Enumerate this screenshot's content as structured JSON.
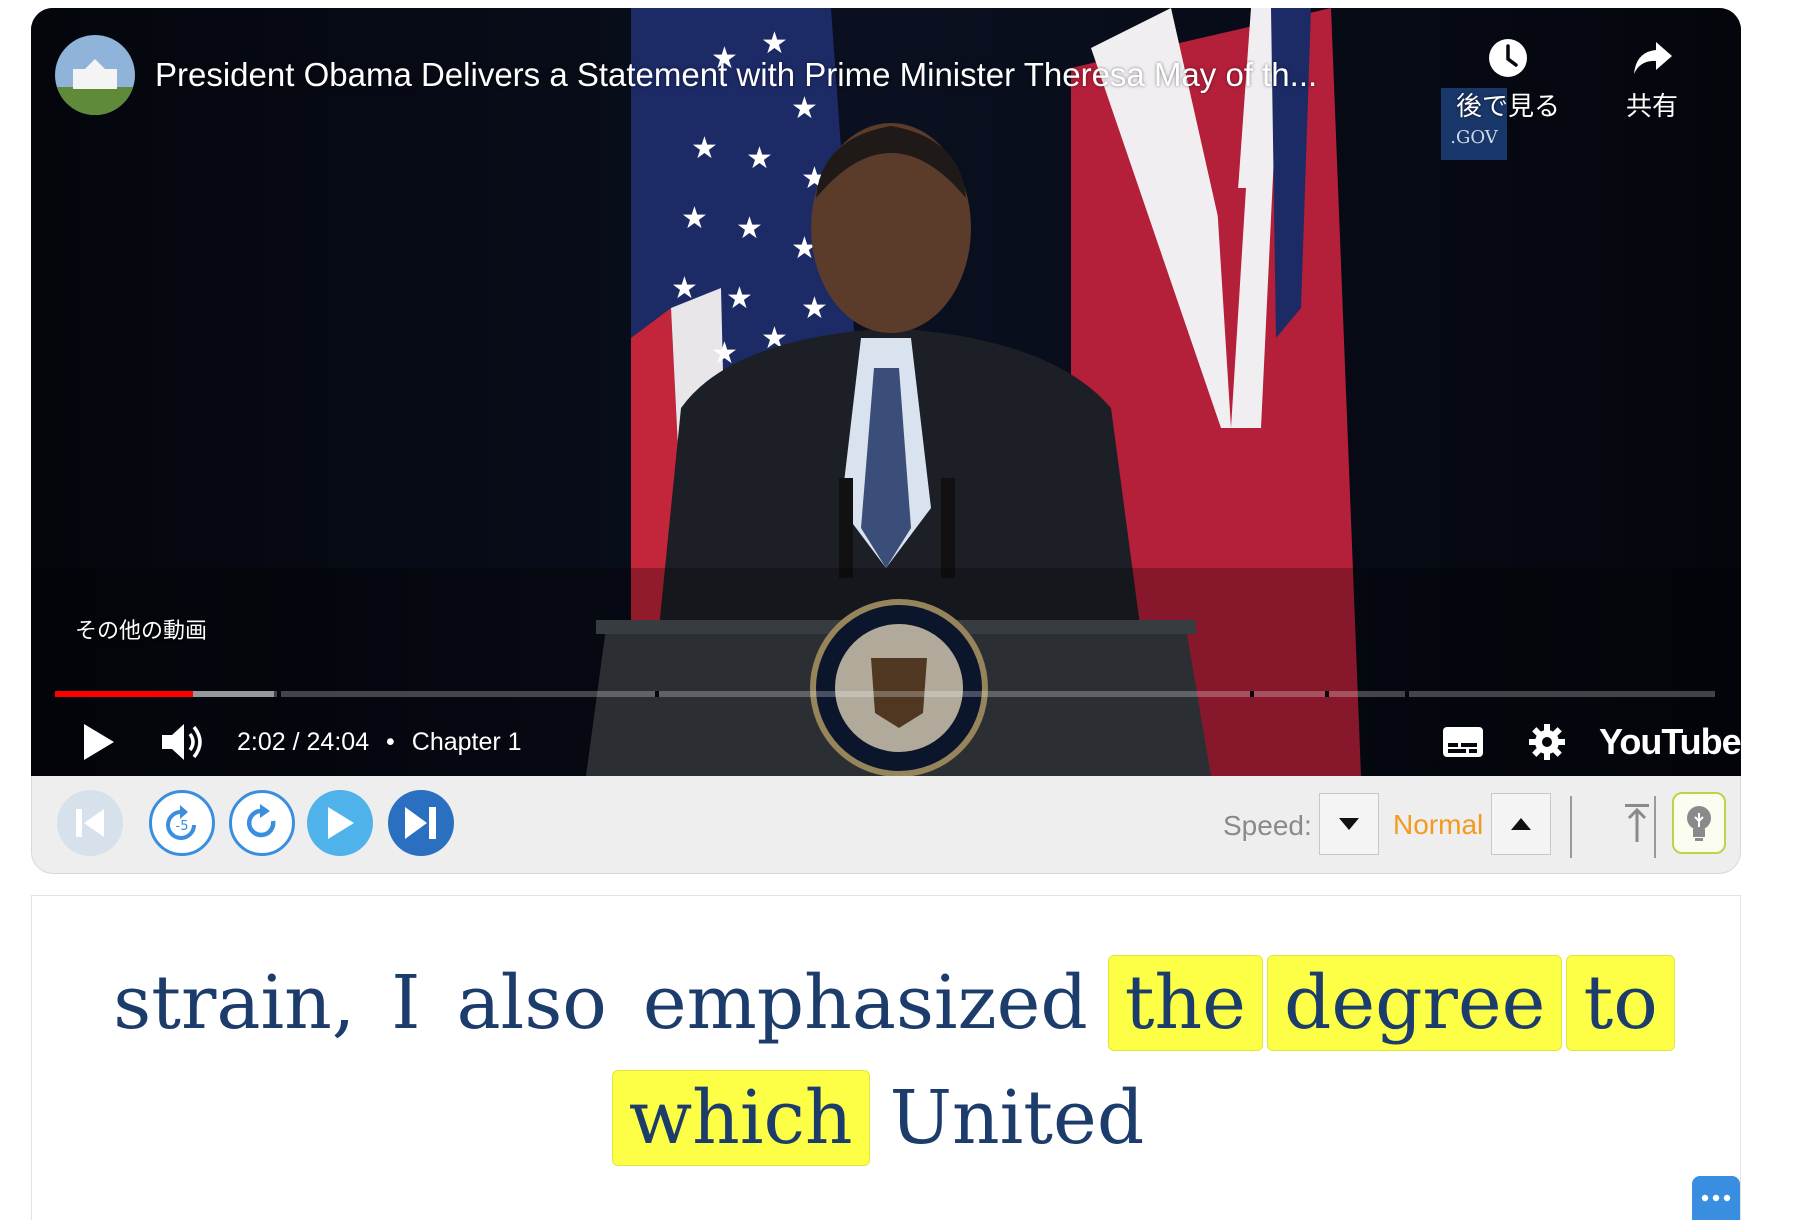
{
  "player": {
    "title": "President Obama Delivers a Statement with Prime Minister Theresa May of th...",
    "watch_later_label": "後で見る",
    "share_label": "共有",
    "more_videos_label": "その他の動画",
    "watermark_text": ".GOV",
    "current_time": "2:02",
    "duration": "24:04",
    "time_separator": "/",
    "chapter_separator": "•",
    "chapter": "Chapter 1",
    "progress_played": 0.083,
    "progress_buffered": 0.132,
    "youtube_logo_text": "YouTube",
    "accent_color": "#ff0000"
  },
  "toolbar": {
    "speed_label": "Speed:",
    "speed_value": "Normal",
    "speed_value_color": "#f39a1e",
    "icons": [
      "skip-back-icon",
      "rewind-5-icon",
      "replay-icon",
      "play-icon",
      "next-icon",
      "scroll-top-icon",
      "lightbulb-icon"
    ]
  },
  "transcript": {
    "line1": [
      {
        "text": "strain,",
        "highlight": false
      },
      {
        "text": "I",
        "highlight": false
      },
      {
        "text": "also",
        "highlight": false
      },
      {
        "text": "emphasized",
        "highlight": false
      },
      {
        "text": "the",
        "highlight": true
      },
      {
        "text": "degree",
        "highlight": true
      },
      {
        "text": "to",
        "highlight": true
      }
    ],
    "line2": [
      {
        "text": "which",
        "highlight": true
      },
      {
        "text": "United",
        "highlight": false
      }
    ],
    "highlight_color": "#fcff45",
    "text_color": "#1c3d6b"
  }
}
